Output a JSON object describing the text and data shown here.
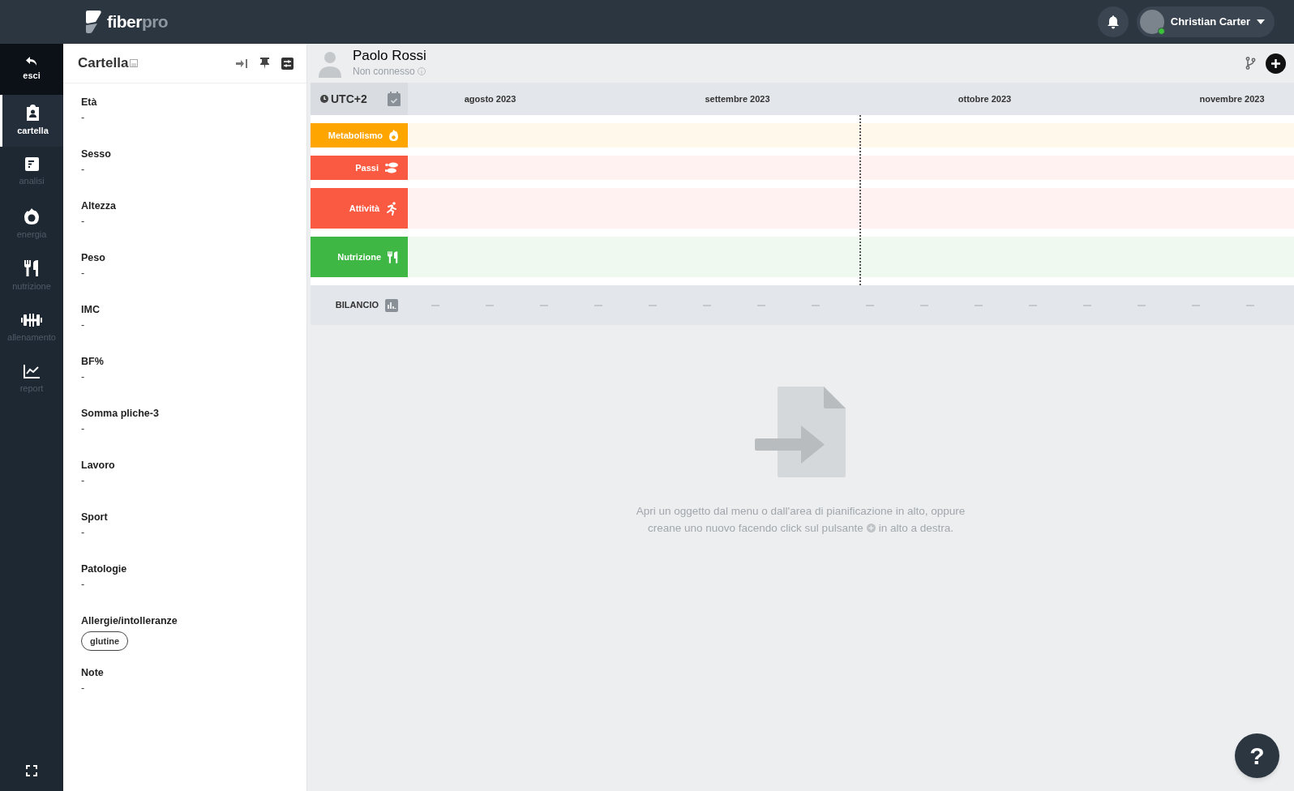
{
  "brand": {
    "name_a": "fiber",
    "name_b": "pro"
  },
  "user": {
    "name": "Christian Carter",
    "online": true
  },
  "nav": {
    "exit_label": "esci",
    "items": [
      {
        "label": "cartella",
        "kind": "folder",
        "selected": true
      },
      {
        "label": "analisi",
        "kind": "doc",
        "selected": false
      },
      {
        "label": "energia",
        "kind": "flame",
        "selected": false
      },
      {
        "label": "nutrizione",
        "kind": "food",
        "selected": false
      },
      {
        "label": "allenamento",
        "kind": "dumbbell",
        "selected": false
      },
      {
        "label": "report",
        "kind": "chart",
        "selected": false
      }
    ]
  },
  "panel": {
    "title": "Cartella",
    "fields": [
      {
        "label": "Età",
        "value": "-"
      },
      {
        "label": "Sesso",
        "value": "-"
      },
      {
        "label": "Altezza",
        "value": "-"
      },
      {
        "label": "Peso",
        "value": "-"
      },
      {
        "label": "IMC",
        "value": "-"
      },
      {
        "label": "BF%",
        "value": "-"
      },
      {
        "label": "Somma pliche-3",
        "value": "-"
      },
      {
        "label": "Lavoro",
        "value": "-"
      },
      {
        "label": "Sport",
        "value": "-"
      },
      {
        "label": "Patologie",
        "value": "-"
      },
      {
        "label": "Allergie/intolleranze",
        "tags": [
          "glutine"
        ]
      },
      {
        "label": "Note",
        "value": "-"
      }
    ]
  },
  "patient": {
    "name": "Paolo Rossi",
    "status": "Non connesso"
  },
  "timeline": {
    "timezone": "UTC+2",
    "months": [
      "agosto 2023",
      "settembre 2023",
      "ottobre 2023",
      "novembre 2023"
    ],
    "rows": [
      {
        "label": "Metabolismo",
        "kind": "flame",
        "color": "#ffa500"
      },
      {
        "label": "Passi",
        "kind": "steps",
        "color": "#fa5a41"
      },
      {
        "label": "Attività",
        "kind": "run",
        "color": "#fa5a41"
      },
      {
        "label": "Nutrizione",
        "kind": "food",
        "color": "#3fb744"
      }
    ],
    "balance_label": "BILANCIO"
  },
  "empty_message": {
    "line_1": "Apri un oggetto dal menu o dall'area di pianificazione in alto, oppure",
    "before": "creane uno nuovo facendo click sul pulsante",
    "after": "in alto a destra."
  },
  "help": {
    "label": "?"
  }
}
